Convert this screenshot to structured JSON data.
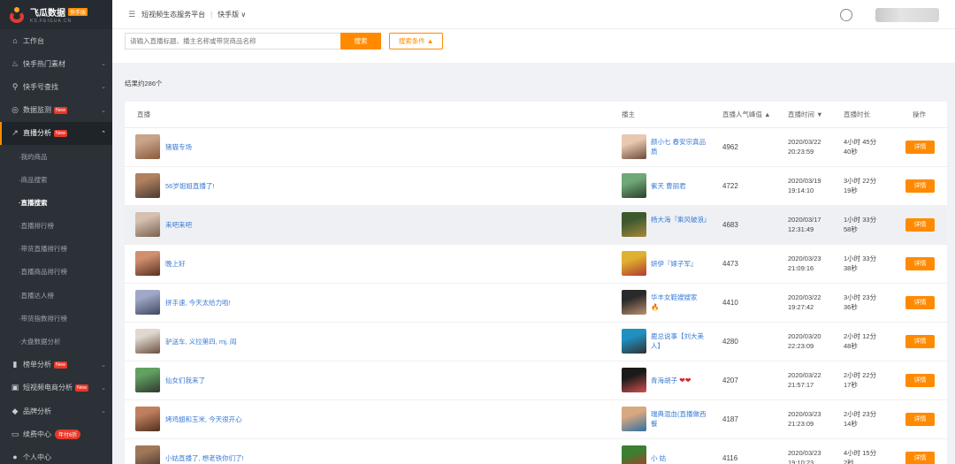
{
  "brand": {
    "name": "飞瓜数据",
    "badge": "快手版",
    "sub": "KS.FEIGUA.CN"
  },
  "sidebar": {
    "items": [
      {
        "label": "工作台",
        "icon": "home-icon",
        "glyph": "⌂",
        "has_arrow": false
      },
      {
        "label": "快手热门素材",
        "icon": "flame-icon",
        "glyph": "♨",
        "has_arrow": true
      },
      {
        "label": "快手号查找",
        "icon": "search-icon",
        "glyph": "⚲",
        "has_arrow": true
      },
      {
        "label": "数据监测",
        "icon": "monitor-icon",
        "glyph": "◎",
        "has_arrow": true,
        "badge": "New"
      },
      {
        "label": "直播分析",
        "icon": "trend-icon",
        "glyph": "↗",
        "has_arrow": true,
        "badge": "New",
        "expanded": true
      },
      {
        "label": "我的商品",
        "sub": true
      },
      {
        "label": "商品搜索",
        "sub": true
      },
      {
        "label": "直播搜索",
        "sub": true,
        "current": true
      },
      {
        "label": "直播排行榜",
        "sub": true
      },
      {
        "label": "带货直播排行榜",
        "sub": true
      },
      {
        "label": "直播商品排行榜",
        "sub": true
      },
      {
        "label": "直播达人榜",
        "sub": true
      },
      {
        "label": "带货指数排行榜",
        "sub": true
      },
      {
        "label": "大盘数据分析",
        "sub": true
      },
      {
        "label": "榜单分析",
        "icon": "bar-chart-icon",
        "glyph": "▮",
        "has_arrow": true,
        "badge": "New"
      },
      {
        "label": "短视频电商分析",
        "icon": "bag-icon",
        "glyph": "▣",
        "has_arrow": true,
        "badge": "New"
      },
      {
        "label": "品牌分析",
        "icon": "diamond-icon",
        "glyph": "◆",
        "has_arrow": true
      },
      {
        "label": "续费中心",
        "icon": "card-icon",
        "glyph": "▭",
        "has_arrow": false,
        "year_badge": "年付6折"
      },
      {
        "label": "个人中心",
        "icon": "user-icon",
        "glyph": "●",
        "has_arrow": false
      }
    ]
  },
  "header": {
    "menu_glyph": "☰",
    "platform": "短视频生态服务平台",
    "separator": "|",
    "version": "快手版",
    "version_caret": "∨"
  },
  "search": {
    "placeholder": "请输入直播标题、播主名称或带货商品名称",
    "button": "搜索",
    "conditions": "搜索条件 ▲"
  },
  "results": {
    "count_text": "结果约286个"
  },
  "table": {
    "columns": {
      "live": "直播",
      "anchor": "播主",
      "peak": "直播人气峰值 ▲",
      "time": "直播时间 ▼",
      "duration": "直播时长",
      "action": "操作"
    },
    "detail_label": "详情",
    "rows": [
      {
        "title": "猪猫专场",
        "anchor": "颜小七 春安宗真品质",
        "peak": "4962",
        "date": "2020/03/22",
        "clock": "20:23:59",
        "dur1": "4小时 45分",
        "dur2": "40秒",
        "thumb": [
          "#c9a38a",
          "#8a5a3c"
        ],
        "avatar": [
          "#e8c8b0",
          "#6b4a3a"
        ]
      },
      {
        "title": "56岁姐姐直播了!",
        "anchor": "紫天 曹丽君",
        "peak": "4722",
        "date": "2020/03/19",
        "clock": "19:14:10",
        "dur1": "3小时 22分",
        "dur2": "19秒",
        "thumb": [
          "#b08060",
          "#4a3a30"
        ],
        "avatar": [
          "#6fa878",
          "#2c3e2a"
        ]
      },
      {
        "title": "来吧来吧",
        "anchor": "杨大海『乘风破浪』",
        "peak": "4683",
        "date": "2020/03/17",
        "clock": "12:31:49",
        "dur1": "1小时 33分",
        "dur2": "58秒",
        "thumb": [
          "#d6c0b0",
          "#7a6050"
        ],
        "avatar": [
          "#3c5a2e",
          "#a8893a"
        ]
      },
      {
        "title": "晚上好",
        "anchor": "妍伊『嫁子军』",
        "peak": "4473",
        "date": "2020/03/23",
        "clock": "21:09:16",
        "dur1": "1小时 33分",
        "dur2": "38秒",
        "thumb": [
          "#d09070",
          "#5a3020"
        ],
        "avatar": [
          "#e0b030",
          "#b03a30"
        ]
      },
      {
        "title": "拼手速, 今天太给力啦!",
        "anchor": "华丰女鞋嫂嫂家",
        "anchor_extra": "🔥",
        "peak": "4410",
        "date": "2020/03/22",
        "clock": "19:27:42",
        "dur1": "3小时 23分",
        "dur2": "36秒",
        "thumb": [
          "#a0a8c8",
          "#404860"
        ],
        "avatar": [
          "#2a2a2a",
          "#c09070"
        ]
      },
      {
        "title": "驴送车, 义拉第四, mj, 阎",
        "anchor": "鹿总说事【刘大美人】",
        "peak": "4280",
        "date": "2020/03/20",
        "clock": "22:23:09",
        "dur1": "2小时 12分",
        "dur2": "48秒",
        "thumb": [
          "#e0d8d0",
          "#6a5040"
        ],
        "avatar": [
          "#2090c0",
          "#303030"
        ]
      },
      {
        "title": "仙女们我来了",
        "anchor": "青海胡子",
        "peak": "4207",
        "date": "2020/03/22",
        "clock": "21:57:17",
        "dur1": "2小时 22分",
        "dur2": "17秒",
        "thumb": [
          "#60a060",
          "#303830"
        ],
        "avatar": [
          "#1a1a1a",
          "#d05050"
        ]
      },
      {
        "title": "烤鸡翅和玉米, 今天很开心",
        "anchor": "瑞典混血(直播做西餐",
        "peak": "4187",
        "date": "2020/03/23",
        "clock": "21:23:09",
        "dur1": "2小时 23分",
        "dur2": "14秒",
        "thumb": [
          "#c08060",
          "#503020"
        ],
        "avatar": [
          "#d8a880",
          "#3070a0"
        ]
      },
      {
        "title": "小姑直播了, 想老铁你们了!",
        "anchor": "小 姑",
        "peak": "4116",
        "date": "2020/03/23",
        "clock": "19:10:23",
        "dur1": "4小时 15分",
        "dur2": "2秒",
        "thumb": [
          "#a07858",
          "#40302a"
        ],
        "avatar": [
          "#3a8030",
          "#c03030"
        ]
      }
    ]
  },
  "colors": {
    "accent": "#ff8a00",
    "sidebar_bg": "#2b3137",
    "link": "#3a7bd5",
    "badge_red": "#e8382b"
  }
}
